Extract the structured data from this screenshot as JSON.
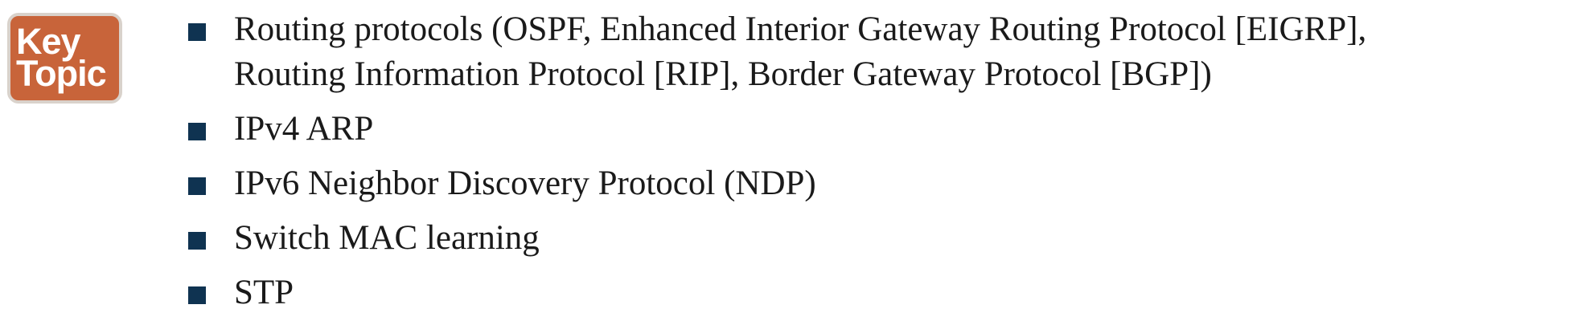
{
  "badge": {
    "line1": "Key",
    "line2": "Topic",
    "color": "#c8643a"
  },
  "bullet_color": "#0f3351",
  "items": [
    {
      "line1": "Routing protocols (OSPF, Enhanced Interior Gateway Routing Protocol [EIGRP],",
      "line2": "Routing Information Protocol [RIP], Border Gateway Protocol [BGP])"
    },
    {
      "line1": "IPv4 ARP"
    },
    {
      "line1": "IPv6 Neighbor Discovery Protocol (NDP)"
    },
    {
      "line1": "Switch MAC learning"
    },
    {
      "line1": "STP"
    }
  ]
}
